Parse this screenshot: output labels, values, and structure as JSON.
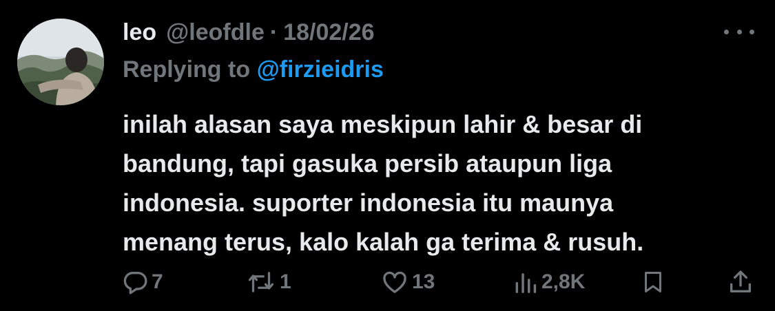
{
  "tweet": {
    "author_name": "leo",
    "author_handle": "@leofdle",
    "separator": "·",
    "date": "18/02/26",
    "replying_prefix": "Replying to ",
    "replying_to": "@firzieidris",
    "text_lines": [
      "inilah alasan saya meskipun lahir & besar di",
      "bandung, tapi gasuka persib ataupun liga",
      "indonesia. suporter indonesia itu maunya",
      "menang terus, kalo kalah ga terima & rusuh."
    ]
  },
  "actions": {
    "replies": "7",
    "reposts": "1",
    "likes": "13",
    "views": "2,8K"
  },
  "icons": {
    "reply": "comment-icon",
    "repost": "repost-icon",
    "like": "heart-icon",
    "views": "views-chart-icon",
    "bookmark": "bookmark-icon",
    "share": "share-icon",
    "more": "more-dots-icon"
  },
  "colors": {
    "background": "#000000",
    "text": "#e7e9ea",
    "secondary": "#71767b",
    "accent": "#1d9bf0"
  }
}
